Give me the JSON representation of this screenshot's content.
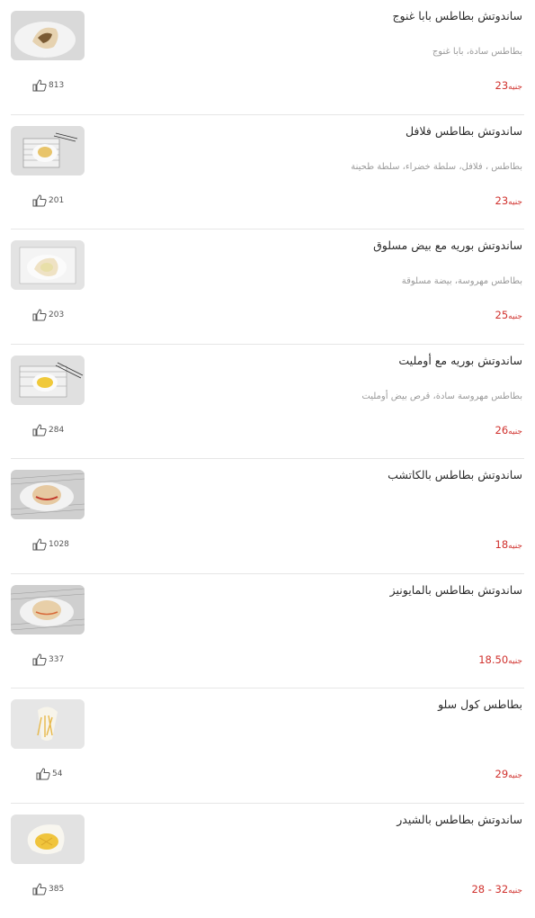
{
  "currency_label": "جنيه",
  "items": [
    {
      "title": "ساندوتش بطاطس بابا غنوج",
      "description": "بطاطس سادة، بابا غنوج",
      "price": "23",
      "likes": "813",
      "thumb_icon": "sandwich-photo"
    },
    {
      "title": "ساندوتش بطاطس فلافل",
      "description": "بطاطس ، فلافل، سلطة خضراء، سلطة طحينة",
      "price": "23",
      "likes": "201",
      "thumb_icon": "fries-plate-photo"
    },
    {
      "title": "ساندوتش بوريه مع بيض مسلوق",
      "description": "بطاطس مهروسة، بيضة مسلوقة",
      "price": "25",
      "likes": "203",
      "thumb_icon": "sandwich-photo"
    },
    {
      "title": "ساندوتش بوريه مع أومليت",
      "description": "بطاطس مهروسة سادة، قرص بيض أومليت",
      "price": "26",
      "likes": "284",
      "thumb_icon": "omelette-photo"
    },
    {
      "title": "ساندوتش بطاطس بالكاتشب",
      "description": "",
      "price": "18",
      "likes": "1028",
      "thumb_icon": "sandwich-photo"
    },
    {
      "title": "ساندوتش بطاطس بالمايونيز",
      "description": "",
      "price": "18.50",
      "likes": "337",
      "thumb_icon": "sandwich-photo"
    },
    {
      "title": "بطاطس كول سلو",
      "description": "",
      "price": "29",
      "likes": "54",
      "thumb_icon": "fries-cone-photo"
    },
    {
      "title": "ساندوتش بطاطس بالشيدر",
      "description": "",
      "price": "28 - 32",
      "likes": "385",
      "thumb_icon": "cheddar-sandwich-photo"
    }
  ],
  "colors": {
    "price": "#d0312d",
    "divider": "#e6e6e6",
    "description": "#9a9a9a"
  }
}
